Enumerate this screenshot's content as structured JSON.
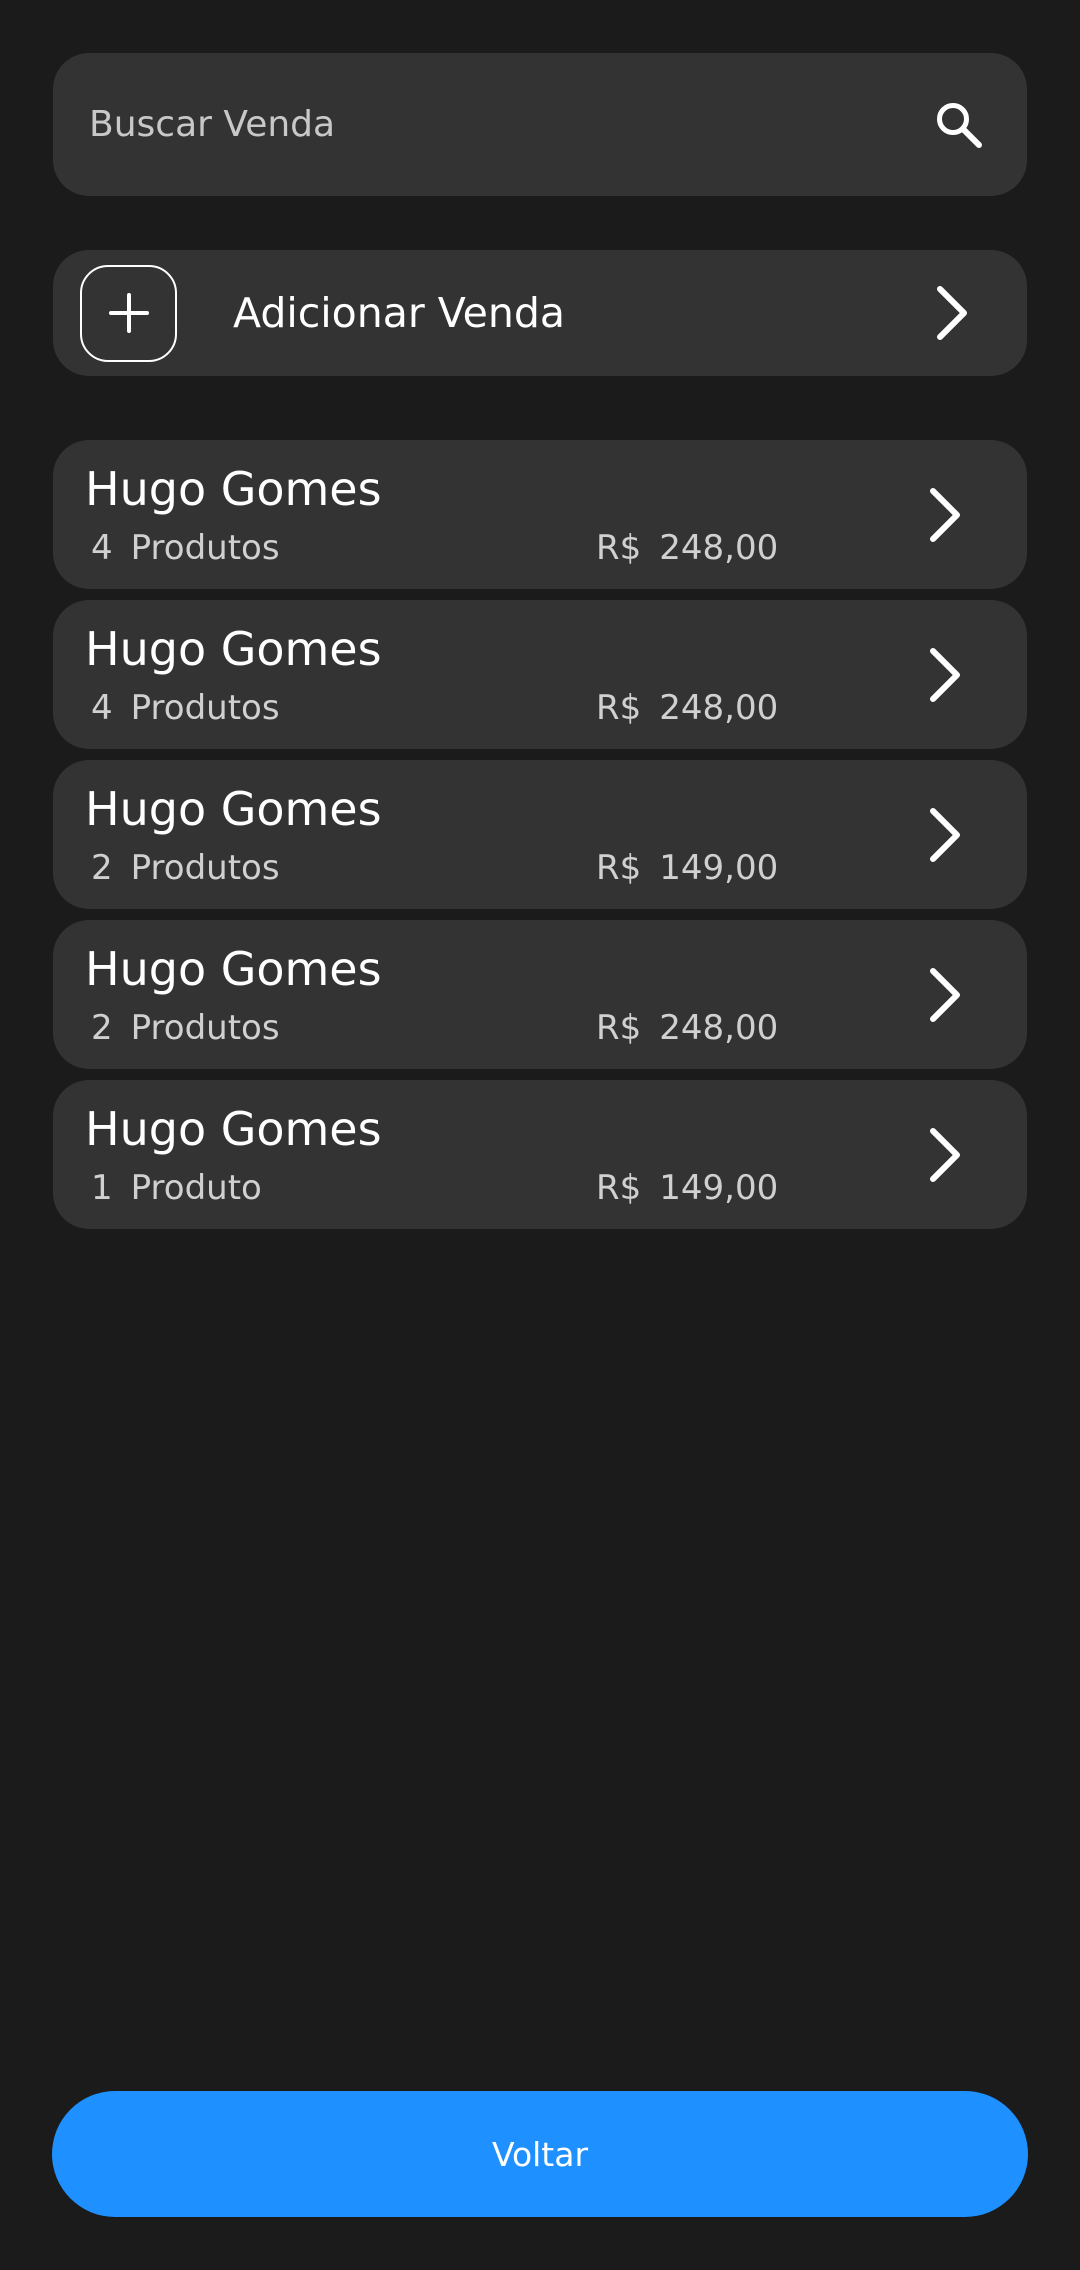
{
  "search": {
    "placeholder": "Buscar Venda",
    "value": "",
    "icon": "search-icon"
  },
  "add_sale": {
    "label": "Adicionar Venda",
    "icon": "plus-icon",
    "chevron": "chevron-right-icon"
  },
  "sales": [
    {
      "customer": "Hugo Gomes",
      "count": "4",
      "unit": "Produtos",
      "currency": "R$",
      "amount": "248,00"
    },
    {
      "customer": "Hugo Gomes",
      "count": "4",
      "unit": "Produtos",
      "currency": "R$",
      "amount": "248,00"
    },
    {
      "customer": "Hugo Gomes",
      "count": "2",
      "unit": "Produtos",
      "currency": "R$",
      "amount": "149,00"
    },
    {
      "customer": "Hugo Gomes",
      "count": "2",
      "unit": "Produtos",
      "currency": "R$",
      "amount": "248,00"
    },
    {
      "customer": "Hugo Gomes",
      "count": "1",
      "unit": "Produto",
      "currency": "R$",
      "amount": "149,00"
    }
  ],
  "footer": {
    "back_label": "Voltar"
  },
  "colors": {
    "background": "#1b1b1b",
    "card": "#333333",
    "accent": "#1e90ff",
    "text": "#ffffff",
    "muted_text": "#d0d0d0"
  }
}
